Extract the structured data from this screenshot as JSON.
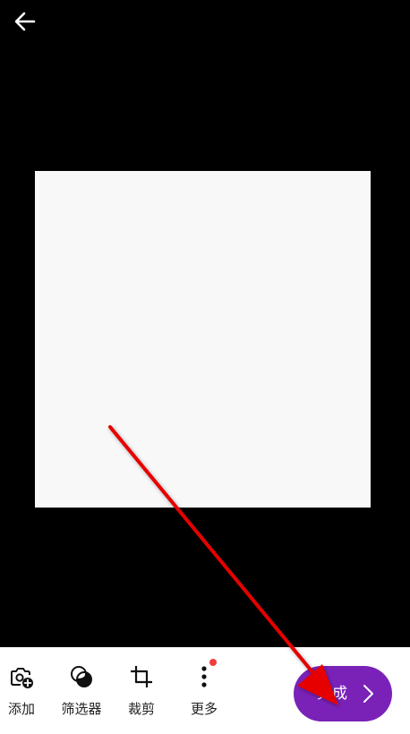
{
  "header": {
    "back_icon": "arrow-left-icon"
  },
  "toolbar": {
    "items": [
      {
        "label": "添加",
        "icon": "camera-plus-icon"
      },
      {
        "label": "筛选器",
        "icon": "filter-circles-icon"
      },
      {
        "label": "裁剪",
        "icon": "crop-icon"
      },
      {
        "label": "更多",
        "icon": "more-vertical-icon",
        "has_badge": true
      }
    ],
    "done_label": "完成"
  },
  "colors": {
    "background": "#000000",
    "preview": "#f8f8f8",
    "toolbar": "#ffffff",
    "accent": "#7a22b8",
    "badge": "#f23c3c",
    "annotation_arrow": "#e60000"
  }
}
